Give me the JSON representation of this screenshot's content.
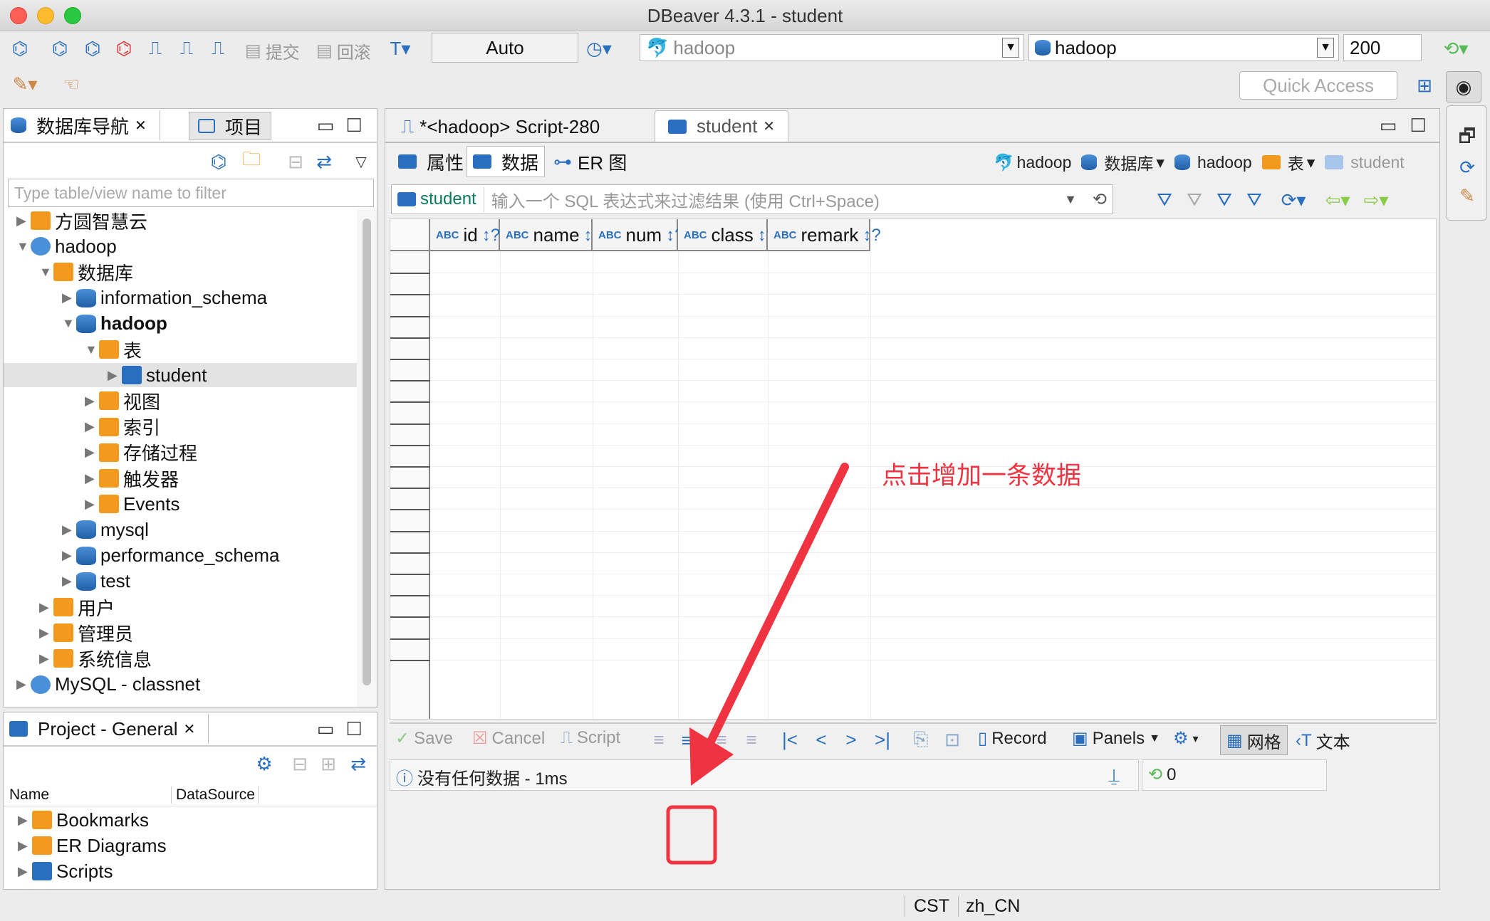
{
  "window": {
    "title": "DBeaver 4.3.1 - student"
  },
  "toolbar": {
    "commit": "提交",
    "rollback": "回滚",
    "txn_mode": "Auto",
    "datasource": "hadoop",
    "schema": "hadoop",
    "limit": "200",
    "quick_access": "Quick Access"
  },
  "navigator": {
    "tab_db": "数据库导航",
    "tab_project": "项目",
    "filter_placeholder": "Type table/view name to filter",
    "tree": [
      {
        "label": "方圆智慧云",
        "indent": 0,
        "icon": "folder",
        "tw": "▶",
        "bold": false
      },
      {
        "label": "hadoop",
        "indent": 0,
        "icon": "dolphin",
        "tw": "▼",
        "bold": false
      },
      {
        "label": "数据库",
        "indent": 1,
        "icon": "db-folder",
        "tw": "▼",
        "bold": false
      },
      {
        "label": "information_schema",
        "indent": 2,
        "icon": "db",
        "tw": "▶",
        "bold": false
      },
      {
        "label": "hadoop",
        "indent": 2,
        "icon": "db",
        "tw": "▼",
        "bold": true
      },
      {
        "label": "表",
        "indent": 3,
        "icon": "table-folder",
        "tw": "▼",
        "bold": false
      },
      {
        "label": "student",
        "indent": 4,
        "icon": "table",
        "tw": "▶",
        "bold": false,
        "selected": true
      },
      {
        "label": "视图",
        "indent": 3,
        "icon": "view",
        "tw": "▶",
        "bold": false
      },
      {
        "label": "索引",
        "indent": 3,
        "icon": "folder",
        "tw": "▶",
        "bold": false
      },
      {
        "label": "存储过程",
        "indent": 3,
        "icon": "folder",
        "tw": "▶",
        "bold": false
      },
      {
        "label": "触发器",
        "indent": 3,
        "icon": "folder",
        "tw": "▶",
        "bold": false
      },
      {
        "label": "Events",
        "indent": 3,
        "icon": "folder",
        "tw": "▶",
        "bold": false
      },
      {
        "label": "mysql",
        "indent": 2,
        "icon": "db",
        "tw": "▶",
        "bold": false
      },
      {
        "label": "performance_schema",
        "indent": 2,
        "icon": "db",
        "tw": "▶",
        "bold": false
      },
      {
        "label": "test",
        "indent": 2,
        "icon": "db",
        "tw": "▶",
        "bold": false
      },
      {
        "label": "用户",
        "indent": 1,
        "icon": "user",
        "tw": "▶",
        "bold": false
      },
      {
        "label": "管理员",
        "indent": 1,
        "icon": "admin",
        "tw": "▶",
        "bold": false
      },
      {
        "label": "系统信息",
        "indent": 1,
        "icon": "info",
        "tw": "▶",
        "bold": false
      },
      {
        "label": "MySQL - classnet",
        "indent": 0,
        "icon": "dolphin",
        "tw": "▶",
        "bold": false
      }
    ]
  },
  "project": {
    "tab": "Project - General",
    "col_name": "Name",
    "col_ds": "DataSource",
    "items": [
      "Bookmarks",
      "ER Diagrams",
      "Scripts"
    ]
  },
  "editor": {
    "tab_script": "*<hadoop> Script-280",
    "tab_student": "student",
    "subtab_props": "属性",
    "subtab_data": "数据",
    "subtab_er": "ER 图",
    "crumbs": {
      "conn": "hadoop",
      "dbs": "数据库",
      "db": "hadoop",
      "tables": "表",
      "table": "student"
    },
    "filter_table": "student",
    "filter_placeholder": "输入一个 SQL 表达式来过滤结果 (使用 Ctrl+Space)",
    "columns": [
      "id",
      "name",
      "num",
      "class",
      "remark"
    ],
    "bottom": {
      "save": "Save",
      "cancel": "Cancel",
      "script": "Script",
      "record": "Record",
      "panels": "Panels",
      "grid": "网格",
      "text": "文本"
    },
    "status": "没有任何数据 - 1ms",
    "count": "0"
  },
  "annotation": {
    "text": "点击增加一条数据",
    "color": "#ef3340"
  },
  "statusbar": {
    "tz": "CST",
    "locale": "zh_CN"
  }
}
